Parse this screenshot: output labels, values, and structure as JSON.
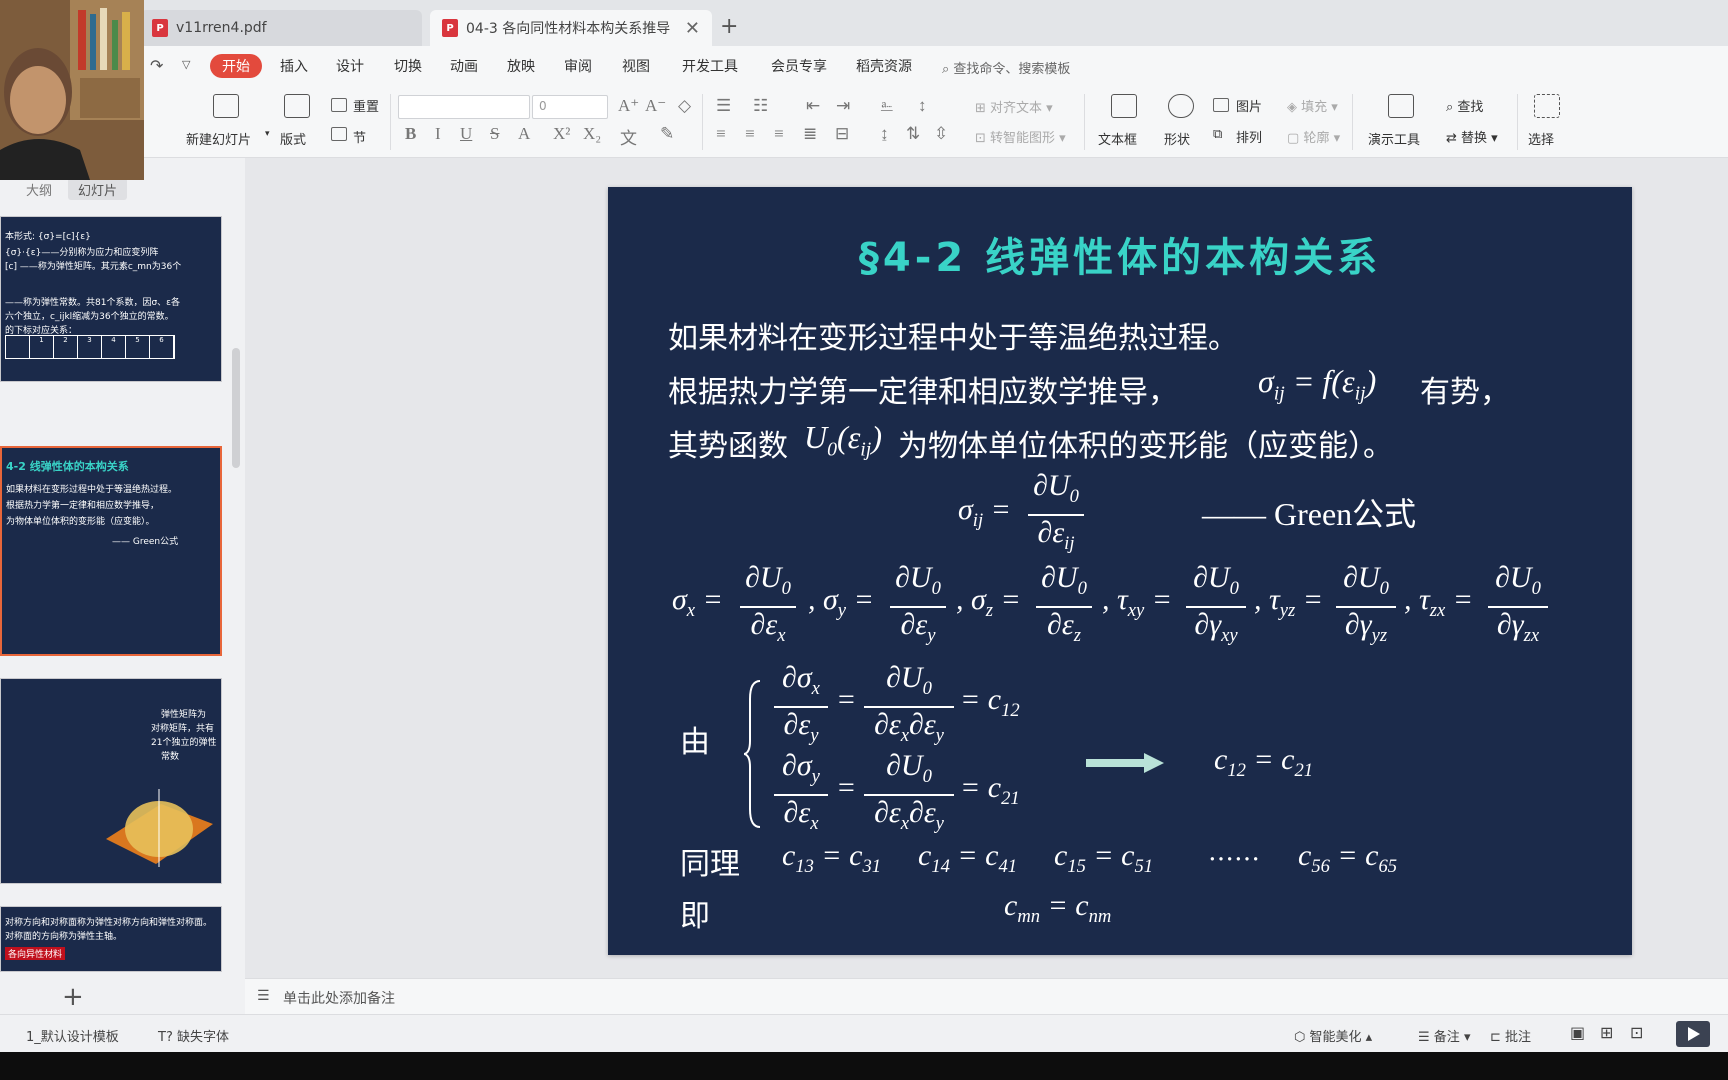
{
  "tabs": [
    {
      "label": "v11rren4.pdf",
      "icon": "pdf-icon"
    },
    {
      "label": "04-3 各向同性材料本构关系推导",
      "icon": "presentation-icon"
    }
  ],
  "menu": [
    "开始",
    "插入",
    "设计",
    "切换",
    "动画",
    "放映",
    "审阅",
    "视图",
    "开发工具",
    "会员专享",
    "稻壳资源"
  ],
  "search_placeholder": "查找命令、搜索模板",
  "ribbon": {
    "new_slide": "新建幻灯片",
    "layout": "版式",
    "reset": "重置",
    "section": "节",
    "font_size": "0",
    "align_text": "对齐文本",
    "smart_shape": "转智能图形",
    "textbox": "文本框",
    "shape": "形状",
    "picture": "图片",
    "arrange": "排列",
    "fill": "填充",
    "outline": "轮廓",
    "present_tool": "演示工具",
    "find": "查找",
    "replace": "替换",
    "select": "选择"
  },
  "panel_tabs": {
    "outline": "大纲",
    "slides": "幻灯片"
  },
  "thumb2_title": "4-2 线弹性体的本构关系",
  "thumb1_lines": [
    "本形式:   {σ}=[c]{ε}",
    "{σ}·{ε}——分别称为应力和应变列阵",
    "[c] ——称为弹性矩阵。其元素c_mn为36个",
    "——称为弹性常数。共81个系数，因σ、ε各",
    "六个独立，c_ijkl缩减为36个独立的常数。",
    "的下标对应关系："
  ],
  "thumb1_grid": [
    "",
    "1",
    "2",
    "3",
    "4",
    "5",
    "6"
  ],
  "thumb3_lines": [
    "弹性矩阵为",
    "对称矩阵，共有",
    "21个独立的弹性",
    "常数"
  ],
  "thumb4_lines": [
    "对称方向和对称面称为弹性对称方向和弹性对称面。",
    "对称面的方向称为弹性主轴。",
    "各向异性材料"
  ],
  "slide": {
    "title": "§4-2  线弹性体的本构关系",
    "line1": "如果材料在变形过程中处于等温绝热过程。",
    "line2a": "根据热力学第一定律和相应数学推导，",
    "line2b": "有势，",
    "line3a": "其势函数",
    "line3b": "为物体单位体积的变形能（应变能）。",
    "green_label": "—— Green公式",
    "you": "由",
    "tongli": "同理",
    "ji": "即",
    "dots": "……"
  },
  "notes_placeholder": "单击此处添加备注",
  "status": {
    "template": "1_默认设计模板",
    "missing_font": "缺失字体",
    "smart_beautify": "智能美化",
    "notes": "备注",
    "comments": "批注"
  }
}
